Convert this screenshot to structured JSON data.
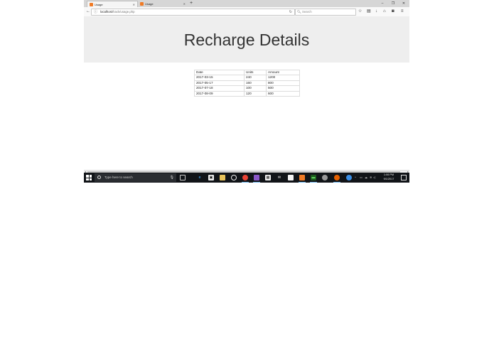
{
  "browser": {
    "tabs": [
      {
        "title": "Usage",
        "active": true
      },
      {
        "title": "Usage",
        "active": false
      }
    ],
    "new_tab_glyph": "+",
    "window_controls": {
      "minimize": "–",
      "maximize": "❐",
      "close": "✕"
    },
    "url": {
      "host": "localhost",
      "path": "/hack/usage.php"
    },
    "search_placeholder": "Search"
  },
  "page": {
    "title": "Recharge Details",
    "table": {
      "headers": [
        "Date",
        "Units",
        "Amount"
      ],
      "rows": [
        [
          "2017-03-15",
          "240",
          "1200"
        ],
        [
          "2017-05-17",
          "160",
          "800"
        ],
        [
          "2017-07-18",
          "100",
          "500"
        ],
        [
          "2017-08-09",
          "120",
          "600"
        ]
      ]
    }
  },
  "taskbar": {
    "search_placeholder": "Type here to search",
    "time": "1:06 PM",
    "date": "9/1/2017"
  },
  "colors": {
    "banner_bg": "#eeeeee",
    "taskbar_bg": "#111418",
    "favicon": "#f07b26"
  }
}
